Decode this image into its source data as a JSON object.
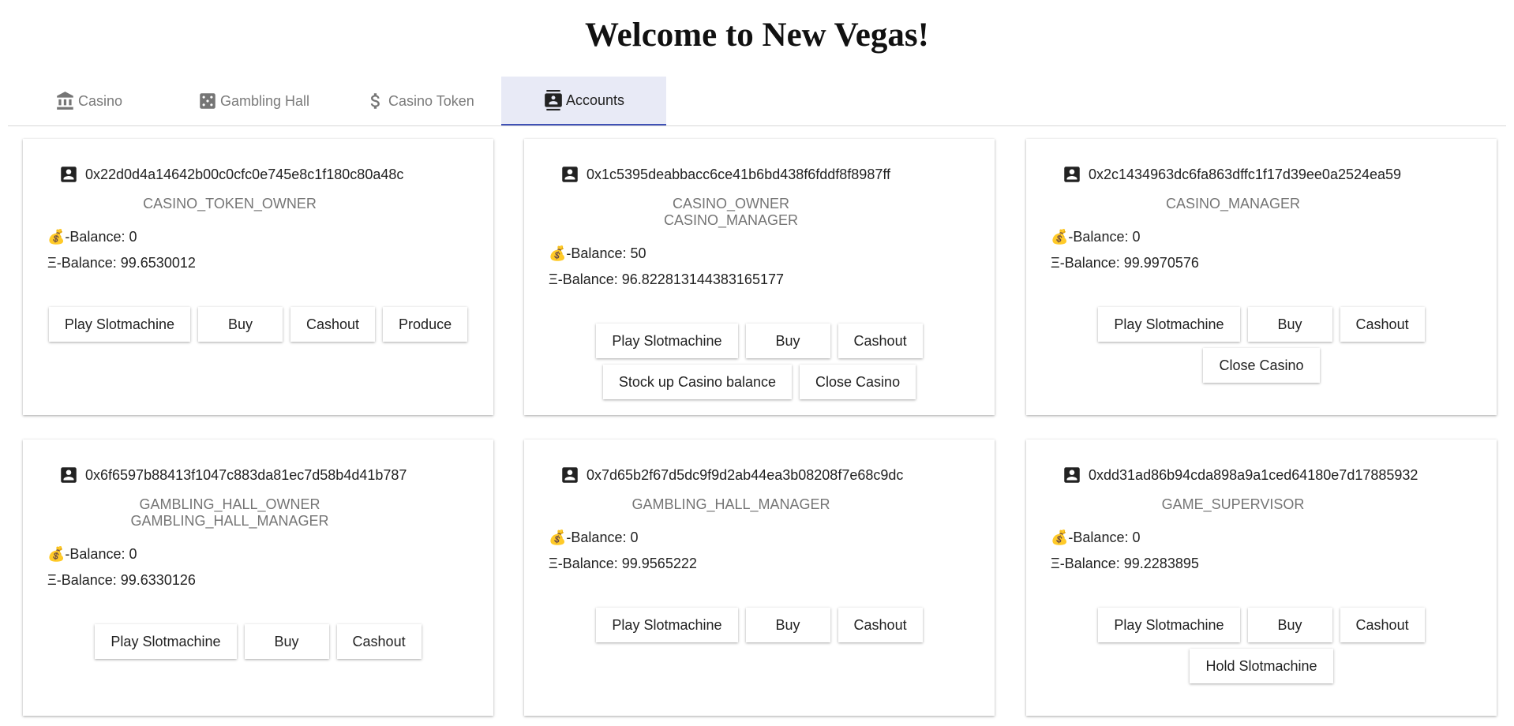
{
  "header": {
    "title": "Welcome to New Vegas!"
  },
  "tabs": [
    {
      "label": "Casino",
      "icon": "bank-icon"
    },
    {
      "label": "Gambling Hall",
      "icon": "dice-icon"
    },
    {
      "label": "Casino Token",
      "icon": "dollar-icon"
    },
    {
      "label": "Accounts",
      "icon": "contacts-icon",
      "active": true
    }
  ],
  "labels": {
    "token_balance": "-Balance:",
    "eth_balance": "Ξ-Balance:"
  },
  "accounts": [
    {
      "address": "0x22d0d4a14642b00c0cfc0e745e8c1f180c80a48c",
      "role1": "CASINO_TOKEN_OWNER",
      "role2": "",
      "token_balance": "0",
      "eth_balance": "99.6530012",
      "buttons": {
        "b0": "Play Slotmachine",
        "b1": "Buy",
        "b2": "Cashout",
        "b3": "Produce"
      }
    },
    {
      "address": "0x1c5395deabbacc6ce41b6bd438f6fddf8f8987ff",
      "role1": "CASINO_OWNER",
      "role2": "CASINO_MANAGER",
      "token_balance": "50",
      "eth_balance": "96.822813144383165177",
      "buttons": {
        "b0": "Play Slotmachine",
        "b1": "Buy",
        "b2": "Cashout",
        "b3": "Stock up Casino balance",
        "b4": "Close Casino"
      }
    },
    {
      "address": "0x2c1434963dc6fa863dffc1f17d39ee0a2524ea59",
      "role1": "CASINO_MANAGER",
      "role2": "",
      "token_balance": "0",
      "eth_balance": "99.9970576",
      "buttons": {
        "b0": "Play Slotmachine",
        "b1": "Buy",
        "b2": "Cashout",
        "b3": "Close Casino"
      }
    },
    {
      "address": "0x6f6597b88413f1047c883da81ec7d58b4d41b787",
      "role1": "GAMBLING_HALL_OWNER",
      "role2": "GAMBLING_HALL_MANAGER",
      "token_balance": "0",
      "eth_balance": "99.6330126",
      "buttons": {
        "b0": "Play Slotmachine",
        "b1": "Buy",
        "b2": "Cashout"
      }
    },
    {
      "address": "0x7d65b2f67d5dc9f9d2ab44ea3b08208f7e68c9dc",
      "role1": "GAMBLING_HALL_MANAGER",
      "role2": "",
      "token_balance": "0",
      "eth_balance": "99.9565222",
      "buttons": {
        "b0": "Play Slotmachine",
        "b1": "Buy",
        "b2": "Cashout"
      }
    },
    {
      "address": "0xdd31ad86b94cda898a9a1ced64180e7d17885932",
      "role1": "GAME_SUPERVISOR",
      "role2": "",
      "token_balance": "0",
      "eth_balance": "99.2283895",
      "buttons": {
        "b0": "Play Slotmachine",
        "b1": "Buy",
        "b2": "Cashout",
        "b3": "Hold Slotmachine"
      }
    }
  ]
}
